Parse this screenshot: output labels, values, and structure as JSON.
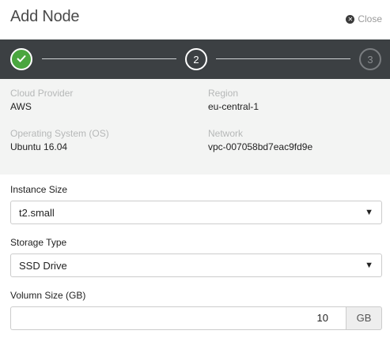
{
  "dialog": {
    "title": "Add Node",
    "close_label": "Close"
  },
  "stepper": {
    "steps": [
      {
        "label": "",
        "state": "completed"
      },
      {
        "label": "2",
        "state": "active"
      },
      {
        "label": "3",
        "state": "pending"
      }
    ]
  },
  "summary": {
    "cloud_provider_label": "Cloud Provider",
    "cloud_provider_value": "AWS",
    "region_label": "Region",
    "region_value": "eu-central-1",
    "os_label": "Operating System (OS)",
    "os_value": "Ubuntu 16.04",
    "network_label": "Network",
    "network_value": "vpc-007058bd7eac9fd9e"
  },
  "form": {
    "instance_size_label": "Instance Size",
    "instance_size_value": "t2.small",
    "storage_type_label": "Storage Type",
    "storage_type_value": "SSD Drive",
    "volume_size_label": "Volumn Size (GB)",
    "volume_size_value": "10",
    "volume_size_unit": "GB"
  },
  "icons": {
    "close": "close-circle-icon",
    "check": "check-icon",
    "caret": "caret-down-icon"
  },
  "colors": {
    "stepper_bg": "#3c4043",
    "step_done": "#4aa63f",
    "summary_bg": "#f3f4f3"
  }
}
